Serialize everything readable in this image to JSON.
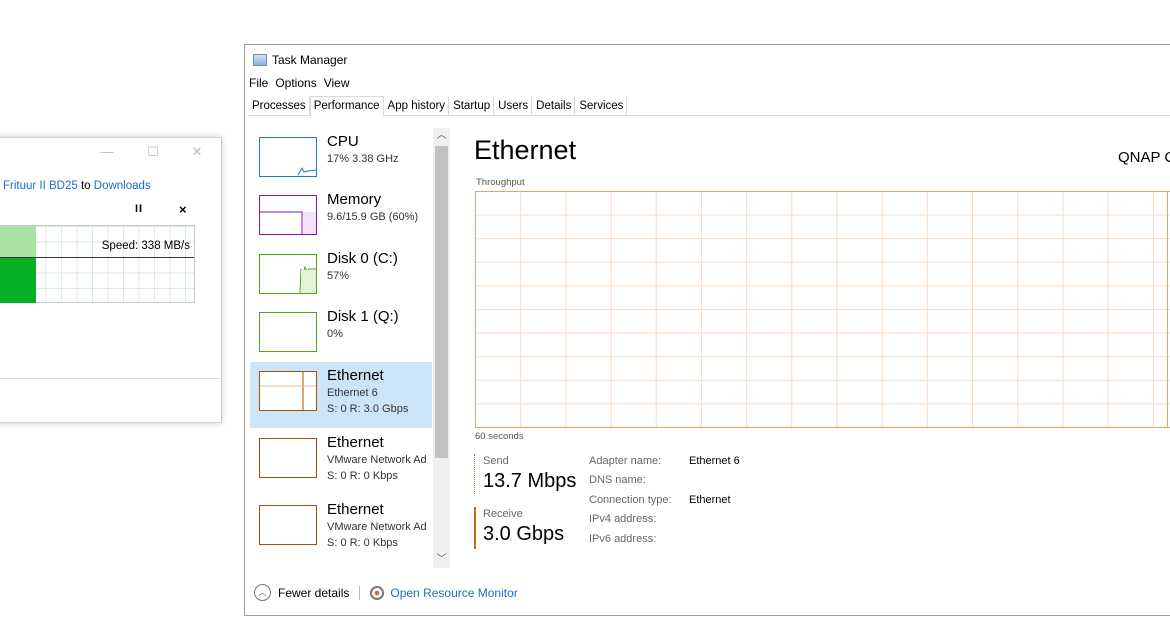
{
  "copy_dialog": {
    "source_name": "Frituur II BD25",
    "connector": " to ",
    "destination": "Downloads",
    "pause_label": "II",
    "close_label": "×",
    "speed_text": "Speed: 338 MB/s",
    "progress_value": 0.19
  },
  "task_manager": {
    "title": "Task Manager",
    "menu": [
      "File",
      "Options",
      "View"
    ],
    "tabs": [
      "Processes",
      "Performance",
      "App history",
      "Startup",
      "Users",
      "Details",
      "Services"
    ],
    "active_tab": "Performance",
    "list": [
      {
        "name": "CPU",
        "line1": "17%  3.38 GHz",
        "line2": "",
        "color": "#1a7bc9"
      },
      {
        "name": "Memory",
        "line1": "9.6/15.9 GB (60%)",
        "line2": "",
        "color": "#8b12ae"
      },
      {
        "name": "Disk 0 (C:)",
        "line1": "57%",
        "line2": "",
        "color": "#4da60c"
      },
      {
        "name": "Disk 1 (Q:)",
        "line1": "0%",
        "line2": "",
        "color": "#4da60c"
      },
      {
        "name": "Ethernet",
        "line1": "Ethernet 6",
        "line2": "S: 0  R: 3.0 Gbps",
        "color": "#a74f01",
        "selected": true
      },
      {
        "name": "Ethernet",
        "line1": "VMware Network Ad",
        "line2": "S: 0  R: 0 Kbps",
        "color": "#a74f01"
      },
      {
        "name": "Ethernet",
        "line1": "VMware Network Ad",
        "line2": "S: 0  R: 0 Kbps",
        "color": "#a74f01"
      }
    ],
    "detail": {
      "title": "Ethernet",
      "adapter_desc": "QNAP C",
      "throughput_label": "Throughput",
      "seconds_label": "60 seconds",
      "send_label": "Send",
      "send_value": "13.7 Mbps",
      "receive_label": "Receive",
      "receive_value": "3.0 Gbps",
      "properties": [
        {
          "key": "Adapter name:",
          "value": "Ethernet 6"
        },
        {
          "key": "DNS name:",
          "value": ""
        },
        {
          "key": "Connection type:",
          "value": "Ethernet"
        },
        {
          "key": "IPv4 address:",
          "value": ""
        },
        {
          "key": "IPv6 address:",
          "value": ""
        }
      ]
    },
    "footer": {
      "fewer_details": "Fewer details",
      "resource_monitor": "Open Resource Monitor"
    }
  }
}
